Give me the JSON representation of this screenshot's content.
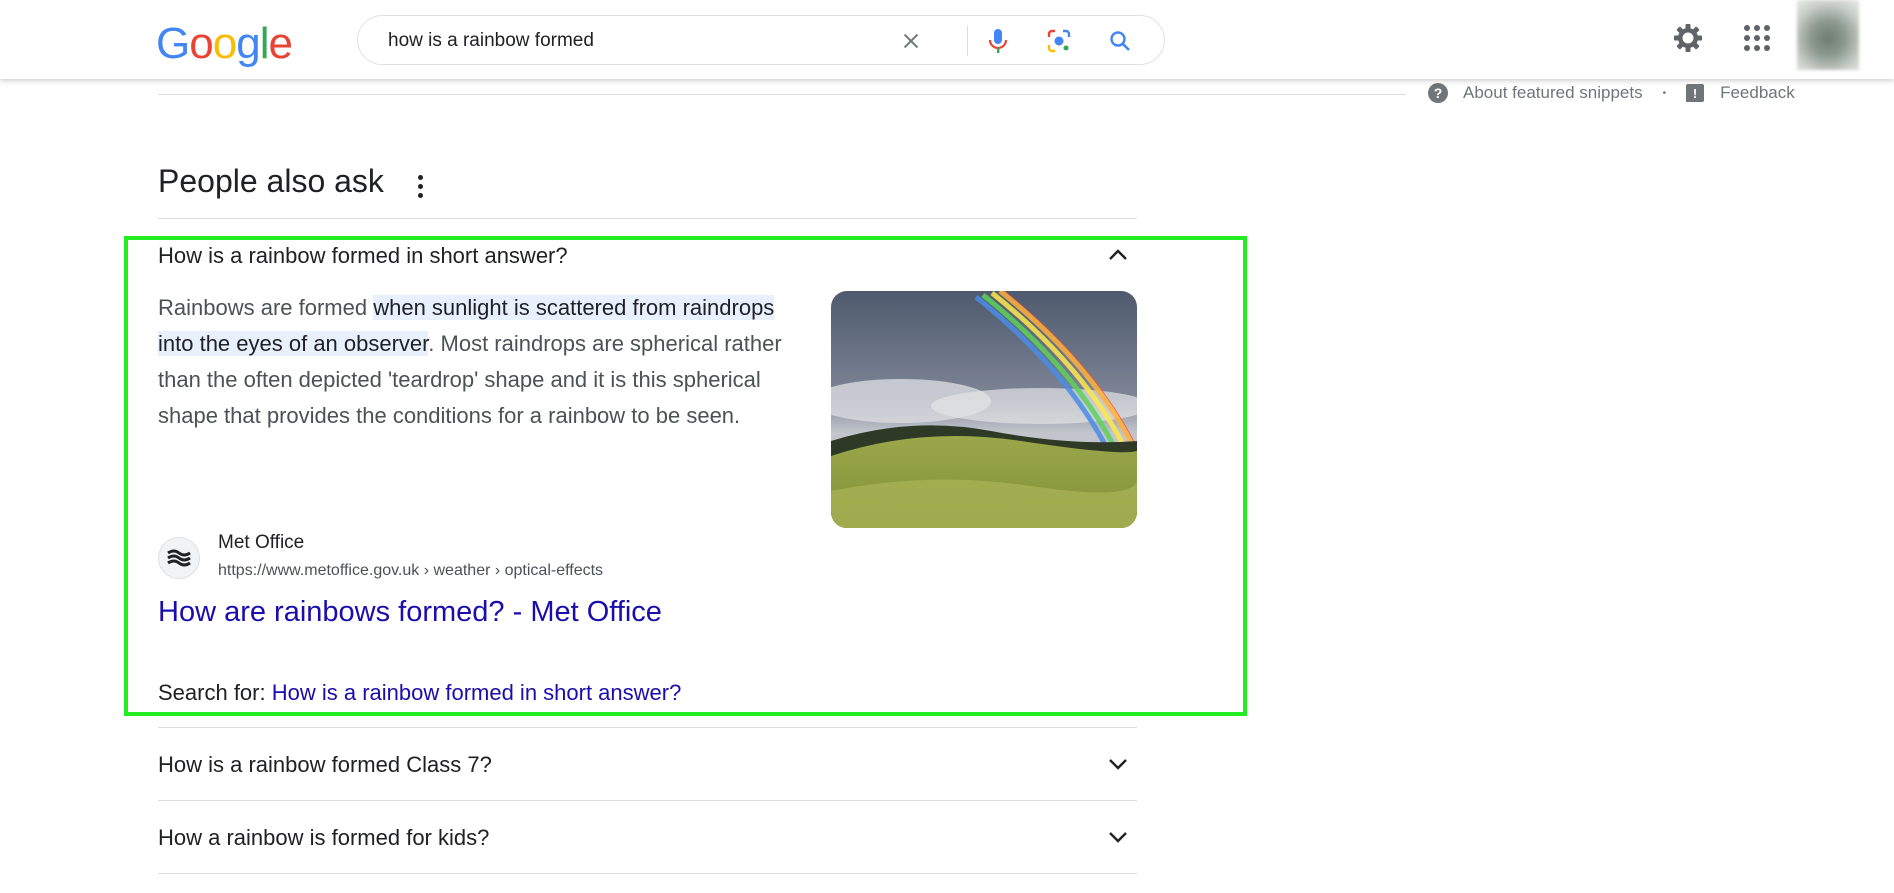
{
  "header": {
    "logo_letters": [
      {
        "char": "G",
        "color": "#4285f4"
      },
      {
        "char": "o",
        "color": "#ea4335"
      },
      {
        "char": "o",
        "color": "#fbbc05"
      },
      {
        "char": "g",
        "color": "#4285f4"
      },
      {
        "char": "l",
        "color": "#34a853"
      },
      {
        "char": "e",
        "color": "#ea4335"
      }
    ],
    "search_query": "how is a rainbow formed",
    "icons": [
      "clear-icon",
      "microphone-icon",
      "lens-icon",
      "search-icon",
      "settings-gear-icon",
      "apps-grid-icon",
      "avatar"
    ]
  },
  "snippet_footer": {
    "about": "About featured snippets",
    "separator": "•",
    "feedback": "Feedback"
  },
  "paa": {
    "title": "People also ask",
    "expanded": {
      "question": "How is a rainbow formed in short answer?",
      "answer_pre": "Rainbows are formed ",
      "answer_highlight": "when sunlight is scattered from raindrops into the eyes of an observer",
      "answer_post": ". Most raindrops are spherical rather than the often depicted 'teardrop' shape and it is this spherical shape that provides the conditions for a rainbow to be seen.",
      "source_name": "Met Office",
      "source_url": "https://www.metoffice.gov.uk › weather › optical-effects",
      "link_title": "How are rainbows formed? - Met Office",
      "search_for_label": "Search for: ",
      "search_for_link": "How is a rainbow formed in short answer?"
    },
    "collapsed": [
      {
        "question": "How is a rainbow formed Class 7?"
      },
      {
        "question": "How a rainbow is formed for kids?"
      }
    ]
  },
  "colors": {
    "link": "#1a0dab",
    "highlight_bg": "#e8f0fe",
    "annotation_box": "#22ee22"
  }
}
